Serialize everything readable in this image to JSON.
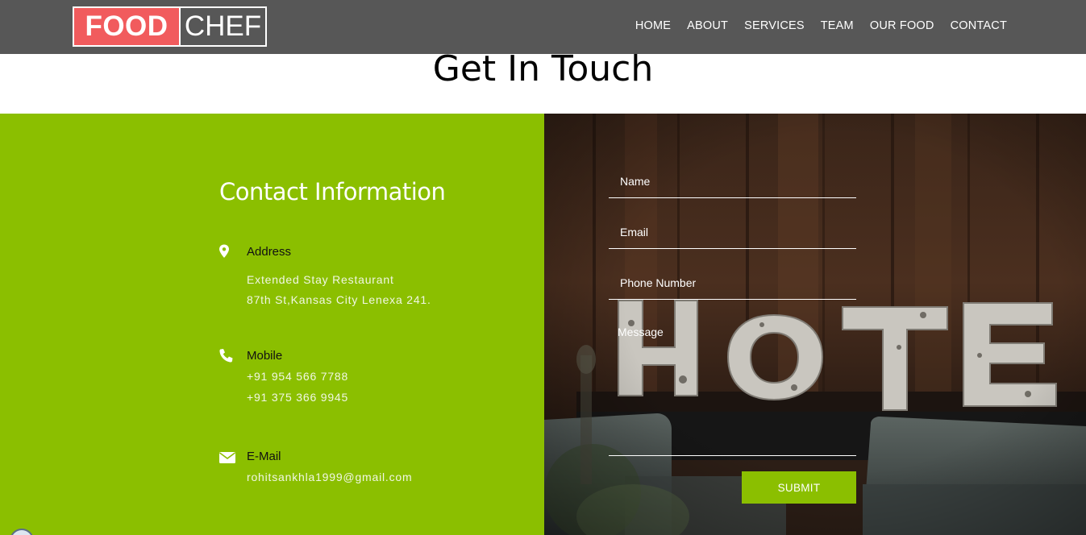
{
  "logo": {
    "part1": "FOOD",
    "part2": "CHEF"
  },
  "nav": {
    "items": [
      "HOME",
      "ABOUT",
      "SERVICES",
      "TEAM",
      "OUR FOOD",
      "CONTACT"
    ]
  },
  "page": {
    "title": "Get In Touch"
  },
  "contact": {
    "heading": "Contact Information",
    "address": {
      "label": "Address",
      "lines": [
        "Extended Stay Restaurant",
        "87th St,Kansas City Lenexa 241."
      ]
    },
    "mobile": {
      "label": "Mobile",
      "lines": [
        "+91 954 566 7788",
        "+91 375 366 9945"
      ]
    },
    "email": {
      "label": "E-Mail",
      "value": "rohitsankhla1999@gmail.com"
    }
  },
  "form": {
    "name_label": "Name",
    "email_label": "Email",
    "phone_label": "Phone Number",
    "message_label": "Message",
    "submit_label": "SUBMIT"
  },
  "background": {
    "sign_letters": [
      "H",
      "O",
      "T",
      "E"
    ]
  },
  "colors": {
    "accent_green": "#8bbf00",
    "logo_red": "#f15b5d",
    "navbar": "#575757"
  }
}
